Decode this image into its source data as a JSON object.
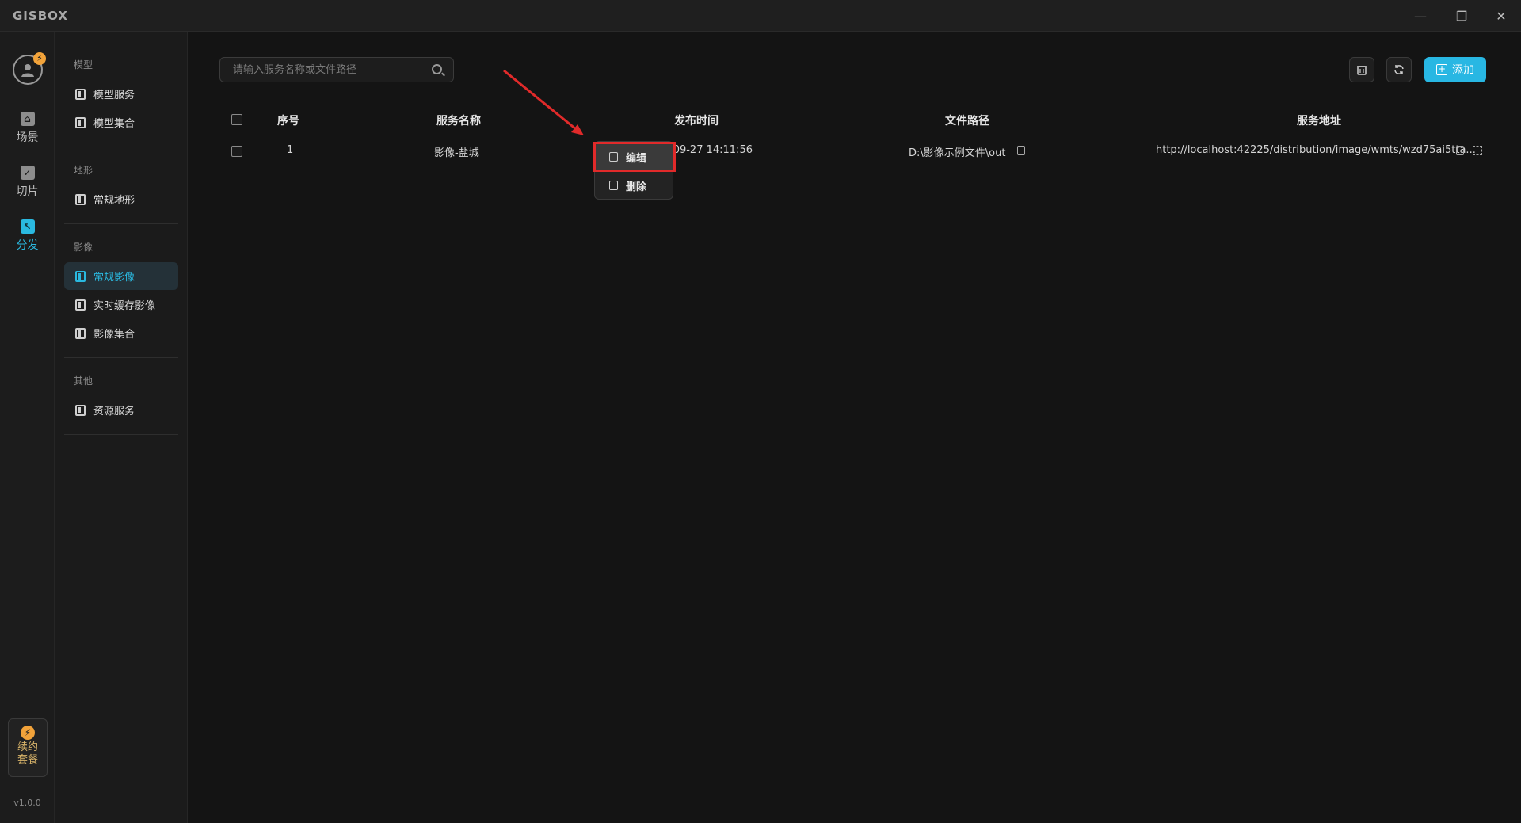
{
  "titlebar": {
    "app_name": "GISBOX",
    "minimize": "—",
    "restore": "❐",
    "close": "✕"
  },
  "rail": {
    "items": [
      {
        "label": "场景",
        "icon": "home-icon"
      },
      {
        "label": "切片",
        "icon": "slice-icon"
      },
      {
        "label": "分发",
        "icon": "distribute-icon"
      }
    ],
    "renew": {
      "line1": "续约",
      "line2": "套餐",
      "icon": "bolt-icon"
    },
    "version": "v1.0.0"
  },
  "sidebar": {
    "groups": [
      {
        "title": "模型",
        "items": [
          "模型服务",
          "模型集合"
        ]
      },
      {
        "title": "地形",
        "items": [
          "常规地形"
        ]
      },
      {
        "title": "影像",
        "items": [
          "常规影像",
          "实时缓存影像",
          "影像集合"
        ]
      },
      {
        "title": "其他",
        "items": [
          "资源服务"
        ]
      }
    ],
    "active_item": "常规影像"
  },
  "toolbar": {
    "search_placeholder": "请输入服务名称或文件路径",
    "add_label": "添加"
  },
  "table": {
    "headers": [
      "序号",
      "服务名称",
      "发布时间",
      "文件路径",
      "服务地址"
    ],
    "rows": [
      {
        "index": "1",
        "name": "影像-盐城",
        "time": "-09-27 14:11:56",
        "path": "D:\\影像示例文件\\out",
        "url": "http://localhost:42225/distribution/image/wmts/wzd75ai5tta..."
      }
    ]
  },
  "context_menu": {
    "edit": "编辑",
    "delete": "删除"
  },
  "colors": {
    "accent": "#28b7e3",
    "highlight": "#e12a2a",
    "renew": "#f2a33a"
  }
}
